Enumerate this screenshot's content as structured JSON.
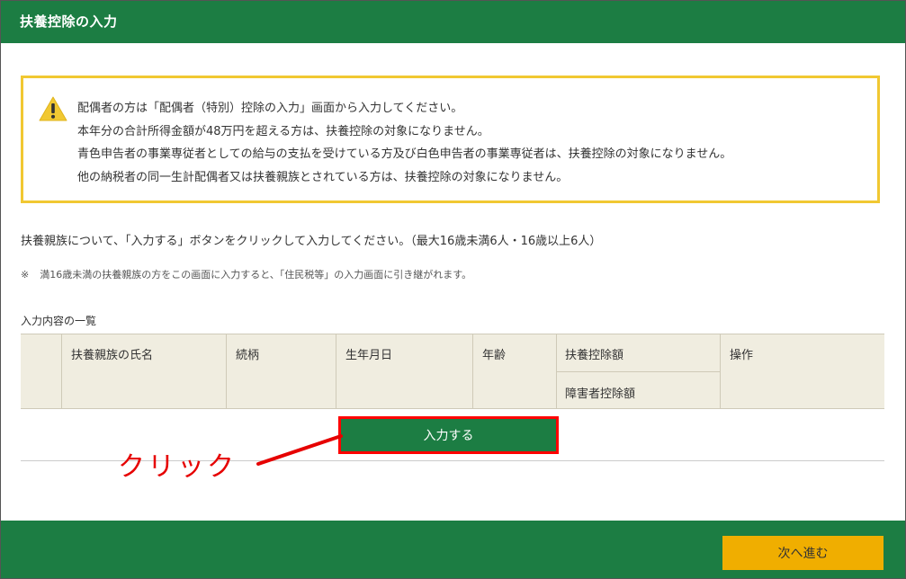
{
  "header": {
    "title": "扶養控除の入力"
  },
  "notice": {
    "icon": "warning-icon",
    "border_color": "#f1c832",
    "lines": [
      "配偶者の方は「配偶者（特別）控除の入力」画面から入力してください。",
      "本年分の合計所得金額が48万円を超える方は、扶養控除の対象になりません。",
      "青色申告者の事業専従者としての給与の支払を受けている方及び白色申告者の事業専従者は、扶養控除の対象になりません。",
      "他の納税者の同一生計配偶者又は扶養親族とされている方は、扶養控除の対象になりません。"
    ]
  },
  "instruction": "扶養親族について、「入力する」ボタンをクリックして入力してください。（最大16歳未満6人・16歳以上6人）",
  "note": {
    "mark": "※",
    "text": "満16歳未満の扶養親族の方をこの画面に入力すると、「住民税等」の入力画面に引き継がれます。"
  },
  "list": {
    "caption": "入力内容の一覧",
    "columns": [
      "扶養親族の氏名",
      "続柄",
      "生年月日",
      "年齢",
      "扶養控除額",
      "操作"
    ],
    "sub_column": "障害者控除額"
  },
  "input_button": "入力する",
  "annotation": {
    "label": "クリック",
    "color": "#e60000"
  },
  "footer": {
    "next_button": "次へ進む"
  },
  "colors": {
    "brand_green": "#1c7d43",
    "accent_yellow": "#f0ae00"
  }
}
